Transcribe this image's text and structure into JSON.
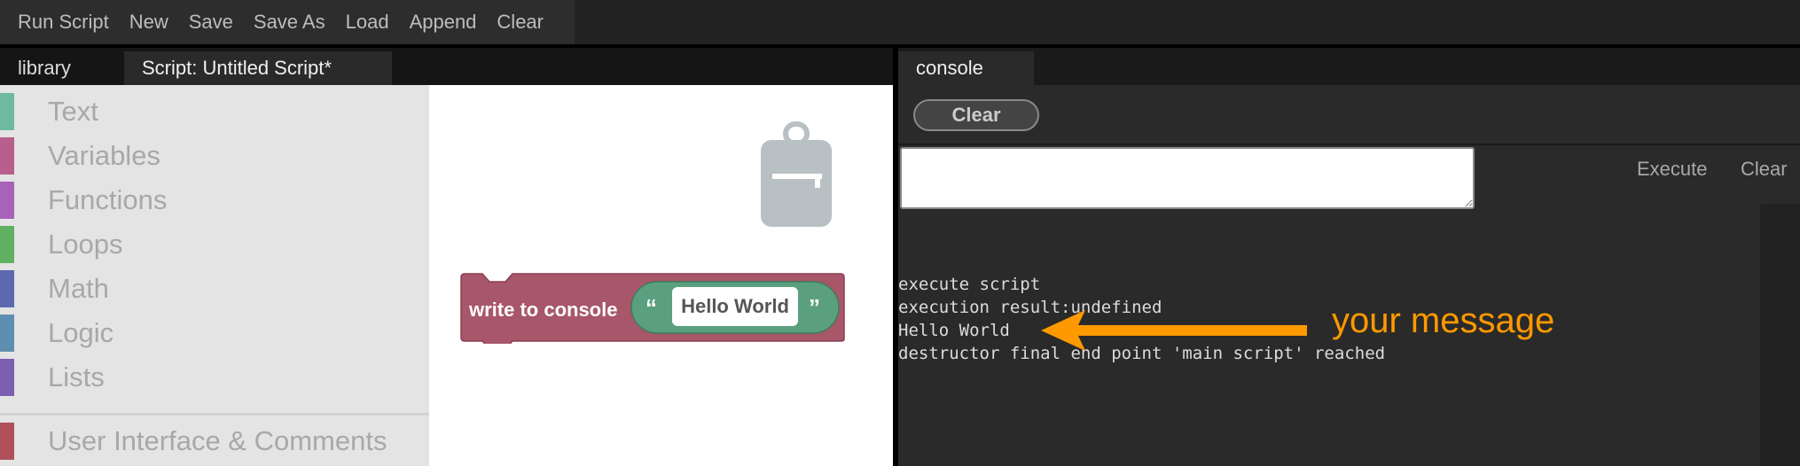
{
  "menu": {
    "items": [
      "Run Script",
      "New",
      "Save",
      "Save As",
      "Load",
      "Append",
      "Clear"
    ]
  },
  "left_tabs": {
    "library": "library",
    "script": "Script: Untitled Script*"
  },
  "library": {
    "categories": [
      {
        "label": "Text",
        "color": "#6fb9a0"
      },
      {
        "label": "Variables",
        "color": "#b85f8e"
      },
      {
        "label": "Functions",
        "color": "#a862b8"
      },
      {
        "label": "Loops",
        "color": "#5fb060"
      },
      {
        "label": "Math",
        "color": "#5c68b0"
      },
      {
        "label": "Logic",
        "color": "#5f8fb0"
      },
      {
        "label": "Lists",
        "color": "#7c5fb0"
      },
      {
        "label": "User Interface & Comments",
        "color": "#b0505a"
      }
    ]
  },
  "workspace": {
    "trash_icon": "trash-can-icon",
    "block": {
      "label": "write to console",
      "open_quote": "“",
      "text": "Hello World",
      "close_quote": "”",
      "block_color": "#a8566a",
      "string_color": "#5aa07e"
    }
  },
  "console": {
    "tab": "console",
    "clear_label": "Clear",
    "input_value": "",
    "execute_label": "Execute",
    "clear_input_label": "Clear",
    "log": [
      "execute script",
      "execution result:undefined",
      "Hello World",
      "destructor final end point 'main script' reached"
    ]
  },
  "annotation": {
    "text": "your message",
    "color": "#ff9900"
  }
}
